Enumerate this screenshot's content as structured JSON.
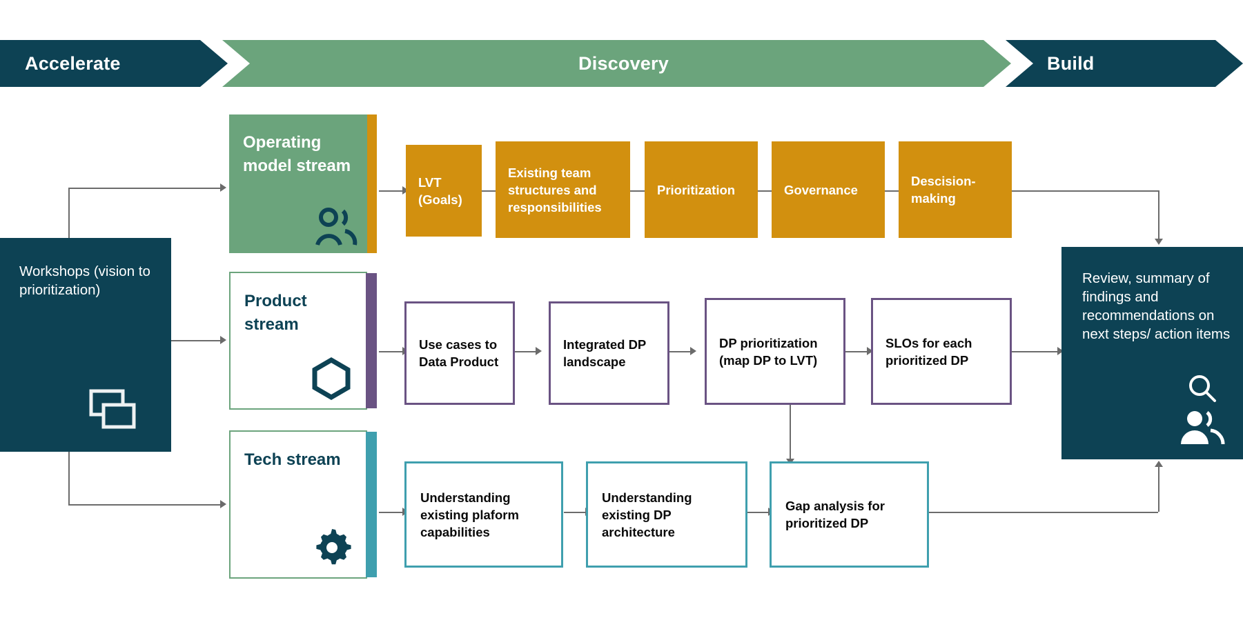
{
  "header": {
    "phases": [
      {
        "key": "accelerate",
        "label": "Accelerate",
        "color": "#0d4254"
      },
      {
        "key": "discovery",
        "label": "Discovery",
        "color": "#6ba47c"
      },
      {
        "key": "build",
        "label": "Build",
        "color": "#0d4254"
      }
    ]
  },
  "start_card": {
    "text": "Workshops (vision to prioritization)",
    "icon": "chat-bubbles-icon",
    "color": "#0d4254"
  },
  "end_card": {
    "text": "Review, summary of findings and recommendations on next steps/ action items",
    "icons": [
      "search-icon",
      "people-icon"
    ],
    "color": "#0d4254"
  },
  "streams": [
    {
      "key": "operating-model",
      "label": "Operating model stream",
      "icon": "people-icon",
      "fill": "#6ba47c",
      "accent": "#d2900f",
      "steps": [
        {
          "label": "LVT (Goals)"
        },
        {
          "label": "Existing team structures and responsibilities"
        },
        {
          "label": "Prioritization"
        },
        {
          "label": "Governance"
        },
        {
          "label": "Descision-making"
        }
      ]
    },
    {
      "key": "product",
      "label": "Product stream",
      "icon": "hexagon-icon",
      "fill": "#ffffff",
      "accent": "#6a5383",
      "steps": [
        {
          "label": "Use cases to Data Product"
        },
        {
          "label": "Integrated DP landscape"
        },
        {
          "label": "DP prioritization (map DP to LVT)"
        },
        {
          "label": "SLOs for each prioritized DP"
        }
      ]
    },
    {
      "key": "tech",
      "label": "Tech stream",
      "icon": "gear-icon",
      "fill": "#ffffff",
      "accent": "#3f9fae",
      "steps": [
        {
          "label": "Understanding existing plaform capabilities"
        },
        {
          "label": "Understanding existing DP architecture"
        },
        {
          "label": "Gap analysis for prioritized DP"
        }
      ]
    }
  ]
}
